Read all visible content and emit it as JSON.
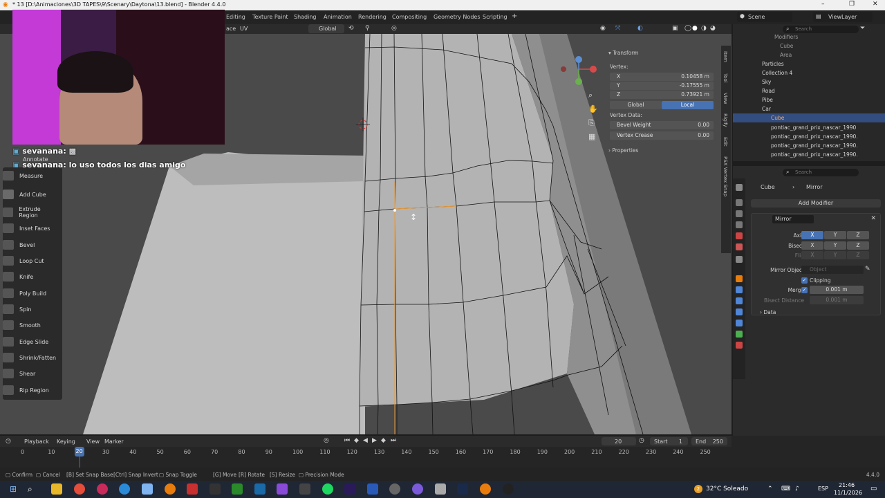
{
  "window": {
    "title": "* 13 [D:\\Animaciones\\3D TAPES\\9\\Scenary\\Daytona\\13.blend] - Blender 4.4.0",
    "minimize": "–",
    "maximize": "❐",
    "close": "✕"
  },
  "topbar": {
    "workspaces": [
      "Editing",
      "Texture Paint",
      "Shading",
      "Animation",
      "Rendering",
      "Compositing",
      "Geometry Nodes",
      "Scripting",
      "+"
    ],
    "scene_label": "Scene",
    "viewlayer_label": "ViewLayer"
  },
  "viewport_header": {
    "mode_fragment": "ace",
    "uv_menu": "UV",
    "orientation": "Global"
  },
  "chat": {
    "line1_user": "sevanana:",
    "line2_user": "sevanana:",
    "line2_msg": "lo uso todos los dias amigo"
  },
  "toolbar": {
    "tools": [
      "Annotate",
      "Measure",
      "Add Cube",
      "Extrude Region",
      "Inset Faces",
      "Bevel",
      "Loop Cut",
      "Knife",
      "Poly Build",
      "Spin",
      "Smooth",
      "Edge Slide",
      "Shrink/Fatten",
      "Shear",
      "Rip Region"
    ]
  },
  "npanel": {
    "section": "Transform",
    "vertex_label": "Vertex:",
    "x_label": "X",
    "x_value": "0.10458 m",
    "y_label": "Y",
    "y_value": "-0.17555 m",
    "z_label": "Z",
    "z_value": "0.73921 m",
    "global_btn": "Global",
    "local_btn": "Local",
    "vertex_data_label": "Vertex Data:",
    "bevel_weight_label": "Bevel Weight",
    "bevel_weight_value": "0.00",
    "vertex_crease_label": "Vertex Crease",
    "vertex_crease_value": "0.00",
    "properties_label": "Properties",
    "side_tabs": [
      "Item",
      "Tool",
      "View",
      "Rigify",
      "Edit",
      "PSX Vertex Snap"
    ]
  },
  "outliner": {
    "search_placeholder": "Search",
    "rows": [
      "Modifiers",
      "Cube",
      "Area",
      "Particles",
      "Collection 4",
      "Sky",
      "Road",
      "Pibe",
      "Car",
      "Cube",
      "pontiac_grand_prix_nascar_1990",
      "pontiac_grand_prix_nascar_1990.",
      "pontiac_grand_prix_nascar_1990.",
      "pontiac_grand_prix_nascar_1990."
    ]
  },
  "properties": {
    "search_placeholder": "Search",
    "breadcrumb_object": "Cube",
    "breadcrumb_modifier": "Mirror",
    "add_modifier": "Add Modifier",
    "modifier_name": "Mirror",
    "axis_label": "Axis",
    "bisect_label": "Bisect",
    "flip_label": "Flip",
    "x": "X",
    "y": "Y",
    "z": "Z",
    "mirror_object_label": "Mirror Object",
    "mirror_object_placeholder": "Object",
    "clipping_label": "Clipping",
    "merge_label": "Merge",
    "merge_value": "0.001 m",
    "bisect_distance_label": "Bisect Distance",
    "bisect_distance_value": "0.001 m",
    "data_label": "Data"
  },
  "timeline": {
    "menus": [
      "Playback",
      "Keying",
      "View",
      "Marker"
    ],
    "current_frame": "20",
    "start_label": "Start",
    "start_value": "1",
    "end_label": "End",
    "end_value": "250",
    "ticks": [
      "0",
      "10",
      "20",
      "30",
      "40",
      "50",
      "60",
      "70",
      "80",
      "90",
      "100",
      "110",
      "120",
      "130",
      "140",
      "150",
      "160",
      "170",
      "180",
      "190",
      "200",
      "210",
      "220",
      "230",
      "240",
      "250"
    ],
    "playhead_frame": 20
  },
  "statusbar": {
    "items": [
      "Confirm",
      "Cancel",
      "Set Snap Base",
      "Snap Invert",
      "Snap Toggle",
      "Move",
      "Rotate",
      "Resize",
      "Precision Mode"
    ],
    "keys": [
      "",
      "",
      "B",
      "Ctrl",
      "",
      "G",
      "R",
      "S",
      ""
    ],
    "version": "4.4.0"
  },
  "taskbar": {
    "weather": "32°C  Soleado",
    "weather_badge": "2",
    "lang": "ESP",
    "time": "21:46",
    "date": "11/1/2026"
  },
  "colors": {
    "accent": "#4772b3",
    "selection_orange": "#e89a3c",
    "viewport_bg": "#4a4a4a"
  }
}
